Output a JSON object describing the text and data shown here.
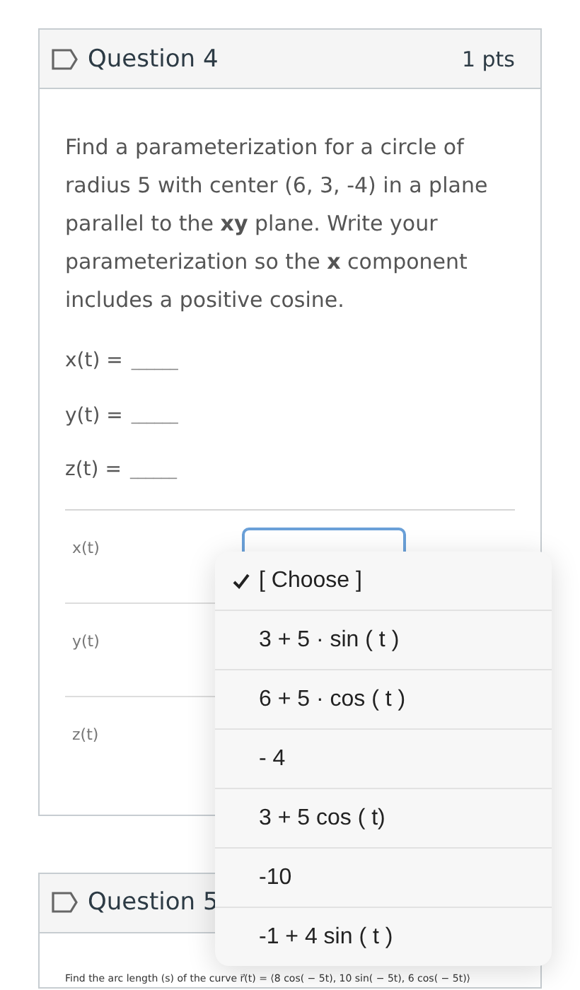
{
  "question": {
    "title": "Question 4",
    "points": "1 pts",
    "text": "Find a parameterization for a circle of radius 5 with center (6, 3, -4) in a plane parallel to the **xy** plane. Write your parameterization so the **x** component includes a positive cosine.",
    "blanks": [
      {
        "label": "x(t) =",
        "blank": "______"
      },
      {
        "label": "y(t) =",
        "blank": "______"
      },
      {
        "label": "z(t) =",
        "blank": "______"
      }
    ],
    "matches": [
      {
        "label": "x(t)",
        "open": true
      },
      {
        "label": "y(t)",
        "open": false
      },
      {
        "label": "z(t)",
        "open": false
      }
    ]
  },
  "dropdown": {
    "options": [
      {
        "label": "[ Choose ]",
        "selected": true
      },
      {
        "label": "3 + 5 · sin ( t )",
        "selected": false
      },
      {
        "label": "6 + 5 · cos ( t )",
        "selected": false
      },
      {
        "label": "- 4",
        "selected": false
      },
      {
        "label": "3 + 5 cos ( t)",
        "selected": false
      },
      {
        "label": "-10",
        "selected": false
      },
      {
        "label": "-1 + 4 sin ( t )",
        "selected": false
      }
    ]
  },
  "next_question": {
    "title": "Question 5",
    "text": "Find the arc length (s) of the curve r⃗(t) = ⟨8 cos( − 5t), 10 sin( − 5t), 6 cos( − 5t)⟩"
  }
}
